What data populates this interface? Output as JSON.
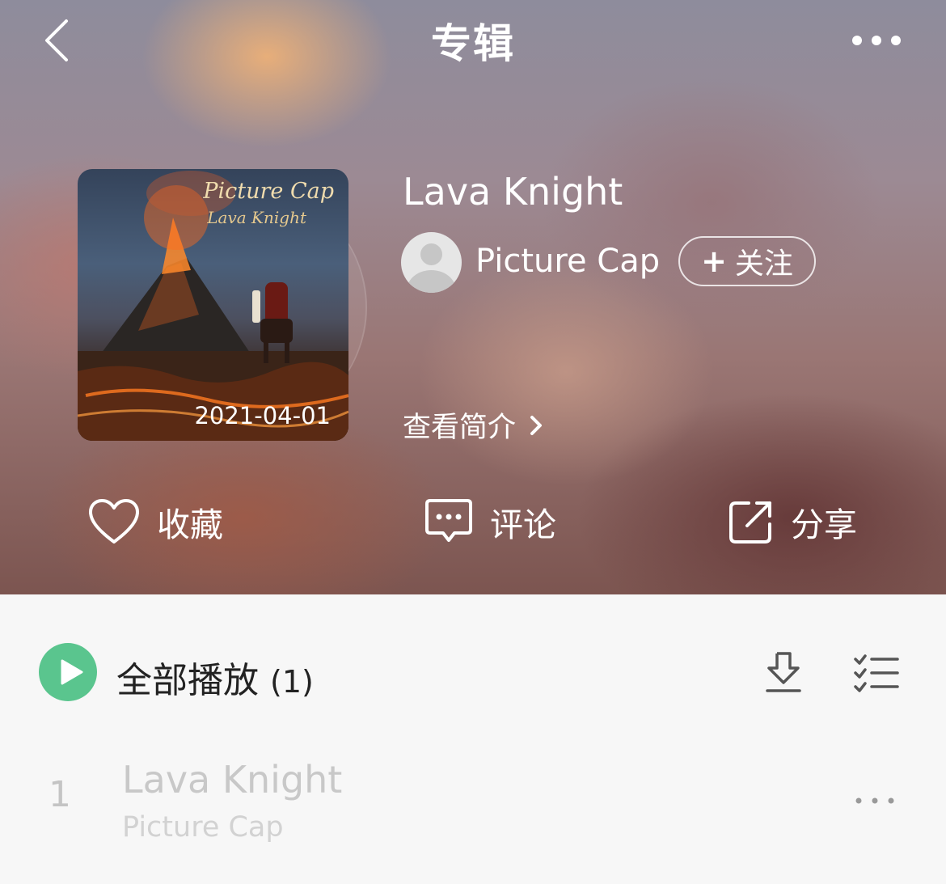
{
  "nav": {
    "title": "专辑"
  },
  "album": {
    "name": "Lava Knight",
    "cover_artist_text": "Picture Cap",
    "cover_album_text": "Lava Knight",
    "release_date": "2021-04-01",
    "artist": "Picture Cap",
    "follow_label": "关注",
    "intro_label": "查看简介"
  },
  "actions": {
    "collect": "收藏",
    "comment": "评论",
    "share": "分享"
  },
  "list": {
    "play_all_label": "全部播放",
    "play_all_count": "(1)",
    "tracks": [
      {
        "index": "1",
        "title": "Lava Knight",
        "artist": "Picture Cap"
      }
    ]
  },
  "colors": {
    "accent_green": "#5ac58e"
  },
  "icons": [
    "back-icon",
    "more-icon",
    "chevron-right-icon",
    "heart-icon",
    "comment-icon",
    "share-icon",
    "play-icon",
    "download-icon",
    "multiselect-icon"
  ]
}
